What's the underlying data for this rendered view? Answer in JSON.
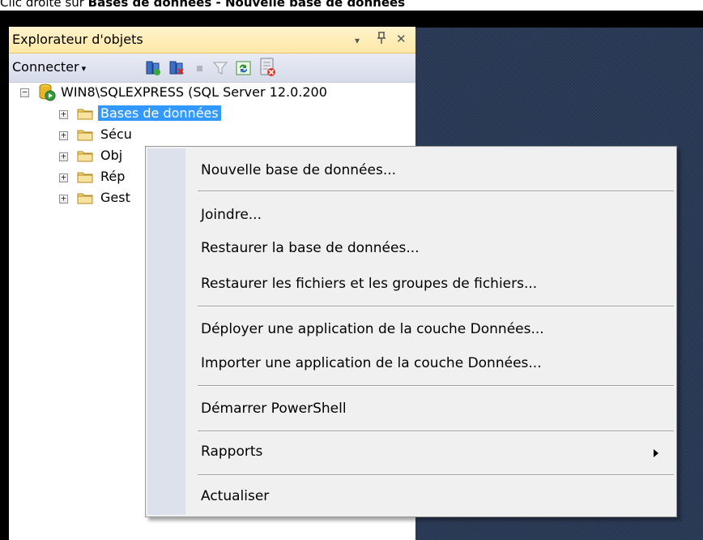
{
  "caption": {
    "prefix": "Clic droite sur ",
    "bold": "Bases de données - Nouvelle base de données"
  },
  "explorer": {
    "title": "Explorateur d'objets",
    "controls": {
      "dropdown": "▾",
      "pin": "ᛉ",
      "close": "✕"
    },
    "toolbar": {
      "connect_label": "Connecter",
      "connect_arrow": "▾",
      "icons": [
        "connect-icon",
        "disconnect-icon",
        "stop-icon",
        "filter-icon",
        "refresh-icon",
        "activity-icon"
      ]
    },
    "tree": {
      "server": "WIN8\\SQLEXPRESS (SQL Server 12.0.200",
      "server_expander": "−",
      "folder_expander": "+",
      "folders": [
        "Bases de données",
        "Sécu",
        "Obj",
        "Rép",
        "Gest"
      ]
    }
  },
  "context_menu": {
    "items": [
      {
        "label": "Nouvelle base de données..."
      },
      {
        "label": "Joindre..."
      },
      {
        "label": "Restaurer la base de données..."
      },
      {
        "label": "Restaurer les fichiers et les groupes de fichiers..."
      },
      {
        "label": "Déployer une application de la couche Données..."
      },
      {
        "label": "Importer une application de la couche Données..."
      },
      {
        "label": "Démarrer PowerShell"
      },
      {
        "label": "Rapports",
        "has_submenu": true
      },
      {
        "label": "Actualiser"
      }
    ]
  },
  "colors": {
    "selection": "#3399ff",
    "title_bar": "#ffe8a6",
    "document_area": "#293955",
    "menu_background": "#f0f0f0",
    "menu_gutter": "#dde1ec"
  }
}
